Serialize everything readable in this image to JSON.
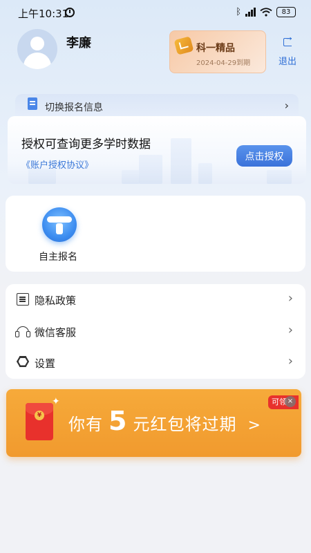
{
  "status_bar": {
    "time": "上午10:31",
    "battery": "83"
  },
  "profile": {
    "name": "李廉",
    "vip_title": "科一精品",
    "vip_expiry": "2024-04-29到期",
    "logout_label": "退出"
  },
  "switch_info": {
    "label": "切换报名信息",
    "arrow": "›"
  },
  "auth": {
    "title": "授权可查询更多学时数据",
    "agreement_link": "《账户授权协议》",
    "button_label": "点击授权"
  },
  "registration": {
    "label": "自主报名"
  },
  "menu": {
    "items": [
      {
        "label": "隐私政策",
        "arrow": "›"
      },
      {
        "label": "微信客服",
        "arrow": "›"
      },
      {
        "label": "设置",
        "arrow": "›"
      }
    ]
  },
  "banner": {
    "prefix": "你有",
    "amount": "5",
    "suffix": "元红包将过期",
    "arrow": ">",
    "tag": "可领"
  },
  "colors": {
    "accent": "#3a72da",
    "banner": "#f19a2e",
    "vip": "#f7c9a6"
  }
}
